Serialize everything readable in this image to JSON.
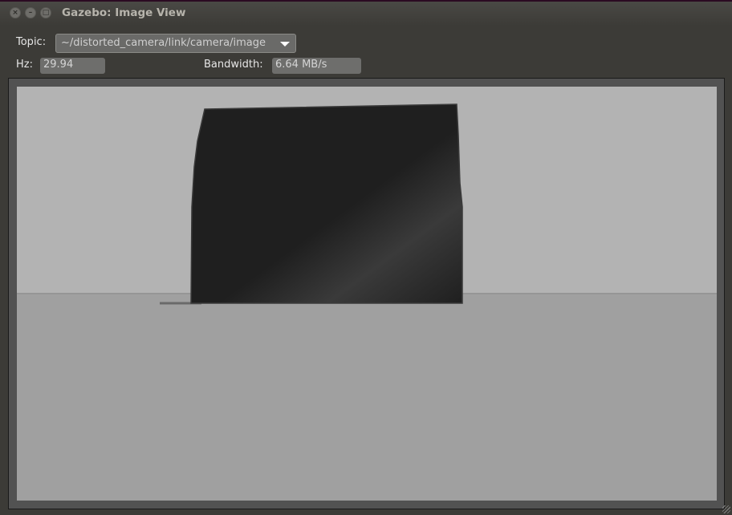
{
  "window": {
    "title": "Gazebo: Image View",
    "buttons": {
      "close_glyph": "×",
      "minimize_glyph": "–",
      "maximize_glyph": "□"
    }
  },
  "toolbar": {
    "topic_label": "Topic:",
    "topic_value": "~/distorted_camera/link/camera/image",
    "hz_label": "Hz:",
    "hz_value": "29.94",
    "bandwidth_label": "Bandwidth:",
    "bandwidth_value": "6.64 MB/s"
  },
  "icons": {
    "close": "close-icon",
    "minimize": "minimize-icon",
    "maximize": "maximize-icon",
    "dropdown": "chevron-down-icon",
    "resize": "resize-grip-icon"
  },
  "colors": {
    "window_bg": "#3c3b37",
    "sky": "#b3b3b3",
    "ground": "#a0a0a0",
    "object": "#1f1f1f"
  }
}
